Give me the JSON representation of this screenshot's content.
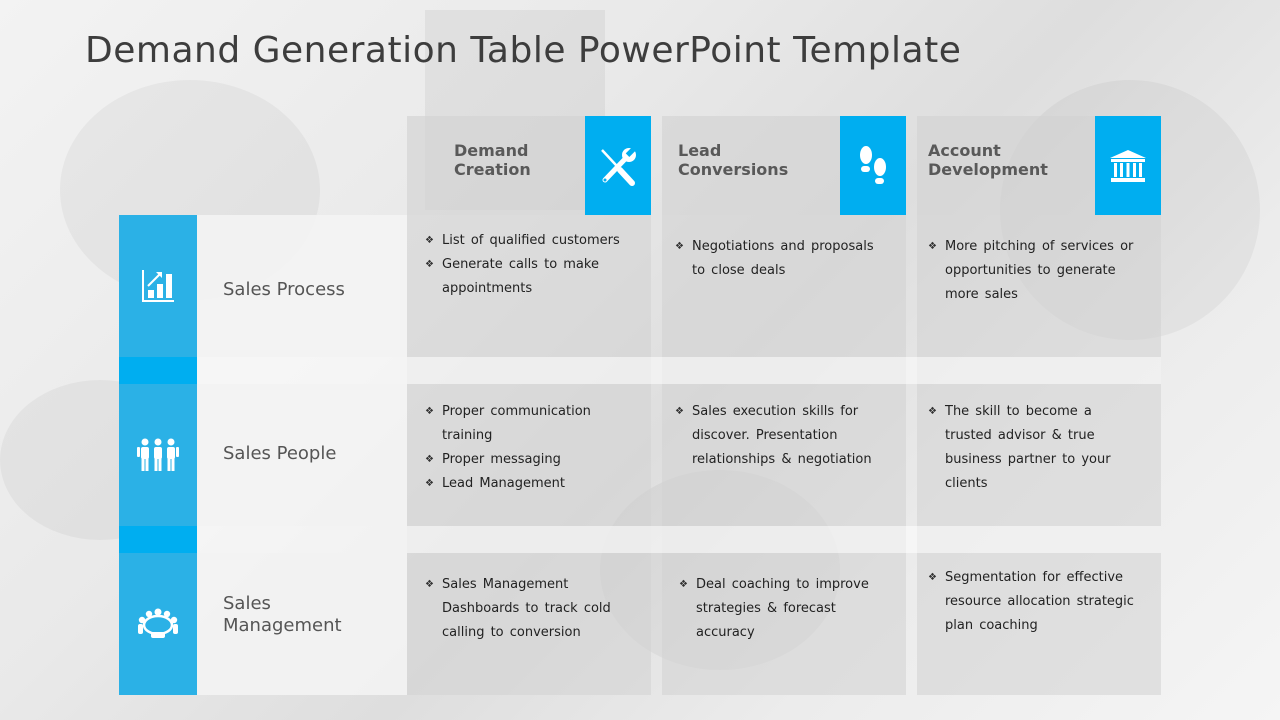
{
  "slide": {
    "title": "Demand Generation Table PowerPoint Template",
    "accent_color": "#00aef0",
    "side_color": "#2bb1e6"
  },
  "columns": [
    {
      "label_line1": "Demand",
      "label_line2": "Creation",
      "icon": "tools-icon"
    },
    {
      "label_line1": "Lead",
      "label_line2": "Conversions",
      "icon": "footprints-icon"
    },
    {
      "label_line1": "Account",
      "label_line2": "Development",
      "icon": "bank-building-icon"
    }
  ],
  "rows": [
    {
      "label": "Sales Process",
      "icon": "bar-chart-growth-icon",
      "cells": [
        [
          "List of qualified customers",
          "Generate calls to make appointments"
        ],
        [
          "Negotiations and proposals to close deals"
        ],
        [
          "More pitching of services or opportunities to generate more sales"
        ]
      ]
    },
    {
      "label": "Sales People",
      "icon": "team-people-icon",
      "cells": [
        [
          "Proper communication training",
          "Proper messaging",
          "Lead Management"
        ],
        [
          "Sales execution skills for discover. Presentation relationships & negotiation"
        ],
        [
          "The skill to become a trusted advisor & true business partner to your clients"
        ]
      ]
    },
    {
      "label_line1": "Sales",
      "label_line2": "Management",
      "icon": "meeting-table-icon",
      "cells": [
        [
          "Sales Management Dashboards to track cold calling to conversion"
        ],
        [
          "Deal coaching to improve strategies & forecast accuracy"
        ],
        [
          "Segmentation for effective resource allocation strategic plan coaching"
        ]
      ]
    }
  ]
}
